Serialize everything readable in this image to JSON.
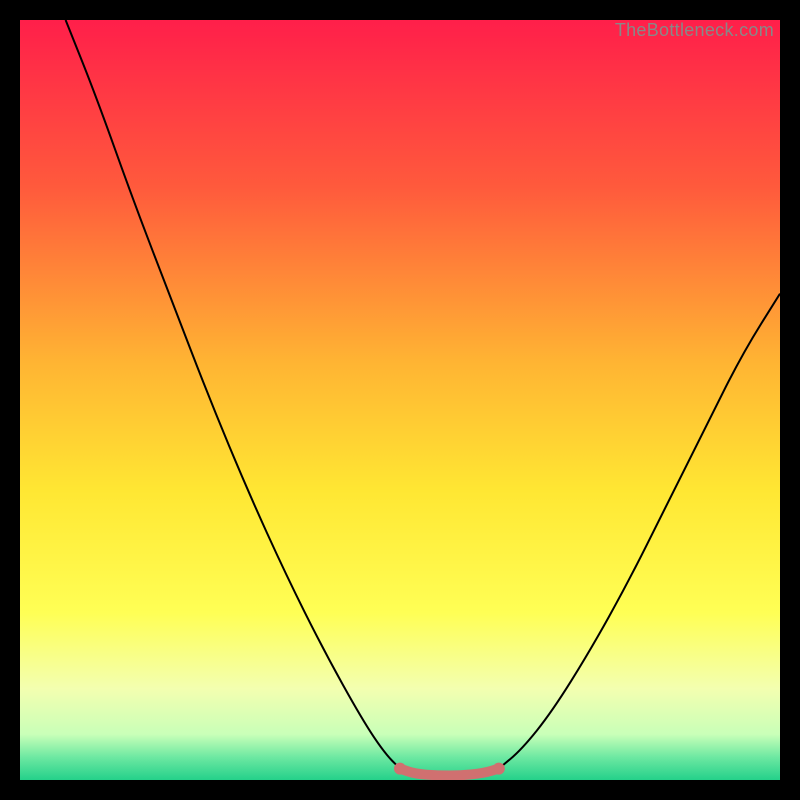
{
  "watermark": "TheBottleneck.com",
  "chart_data": {
    "type": "line",
    "title": "",
    "xlabel": "",
    "ylabel": "",
    "xlim": [
      0,
      100
    ],
    "ylim": [
      0,
      100
    ],
    "grid": false,
    "legend": false,
    "axes_visible": false,
    "background_gradient": {
      "stops": [
        {
          "offset": 0.0,
          "color": "#ff1f4a"
        },
        {
          "offset": 0.22,
          "color": "#ff5a3c"
        },
        {
          "offset": 0.45,
          "color": "#ffb433"
        },
        {
          "offset": 0.62,
          "color": "#ffe733"
        },
        {
          "offset": 0.78,
          "color": "#ffff55"
        },
        {
          "offset": 0.88,
          "color": "#f3ffb0"
        },
        {
          "offset": 0.94,
          "color": "#c9ffb8"
        },
        {
          "offset": 0.97,
          "color": "#6de8a2"
        },
        {
          "offset": 1.0,
          "color": "#24d18a"
        }
      ]
    },
    "series": [
      {
        "name": "left-descent",
        "x": [
          6,
          10,
          15,
          20,
          25,
          30,
          35,
          40,
          45,
          48,
          50
        ],
        "y": [
          100,
          90,
          76,
          63,
          50,
          38,
          27,
          17,
          8,
          3.5,
          1.5
        ]
      },
      {
        "name": "right-ascent",
        "x": [
          63,
          66,
          70,
          75,
          80,
          85,
          90,
          95,
          100
        ],
        "y": [
          1.5,
          4,
          9,
          17,
          26,
          36,
          46,
          56,
          64
        ]
      },
      {
        "name": "flat-optimum",
        "x": [
          50,
          52,
          55,
          58,
          61,
          63
        ],
        "y": [
          1.5,
          0.8,
          0.6,
          0.6,
          0.9,
          1.5
        ]
      }
    ],
    "marker_points": [
      {
        "x": 50,
        "y": 1.5
      },
      {
        "x": 63,
        "y": 1.5
      }
    ]
  }
}
